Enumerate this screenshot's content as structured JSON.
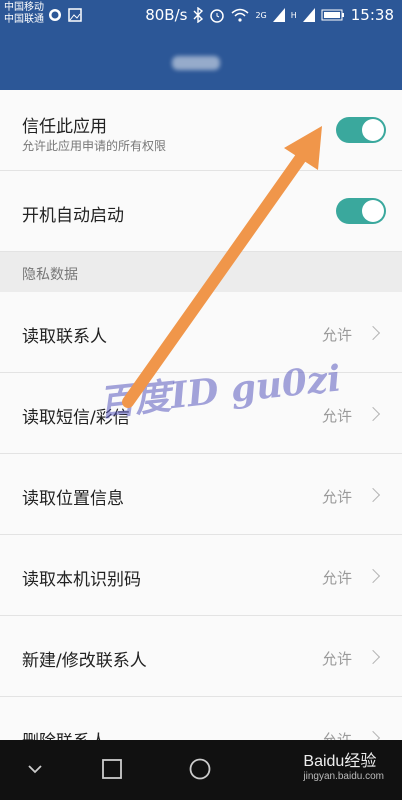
{
  "status_bar": {
    "carrier1": "中国移动",
    "carrier2": "中国联通",
    "speed": "80B/s",
    "net1": "2G",
    "net2": "H",
    "time": "15:38"
  },
  "settings": {
    "trust_app": {
      "label": "信任此应用",
      "description": "允许此应用申请的所有权限",
      "enabled": true
    },
    "auto_start": {
      "label": "开机自动启动",
      "enabled": true
    },
    "privacy_section": "隐私数据",
    "permissions": [
      {
        "label": "读取联系人",
        "value": "允许"
      },
      {
        "label": "读取短信/彩信",
        "value": "允许"
      },
      {
        "label": "读取位置信息",
        "value": "允许"
      },
      {
        "label": "读取本机识别码",
        "value": "允许"
      },
      {
        "label": "新建/修改联系人",
        "value": "允许"
      },
      {
        "label": "删除联系人",
        "value": "允许"
      }
    ]
  },
  "overlays": {
    "watermark": "百度ID gu0zi",
    "jingyan_logo": "Baidu经验",
    "jingyan_url": "jingyan.baidu.com"
  },
  "colors": {
    "header": "#2c5797",
    "toggle_on": "#3aa89d",
    "arrow": "#f0964a"
  },
  "icons": [
    "bluetooth-icon",
    "alarm-icon",
    "wifi-icon",
    "signal-icon",
    "battery-icon",
    "back-icon",
    "home-icon",
    "recents-icon"
  ]
}
